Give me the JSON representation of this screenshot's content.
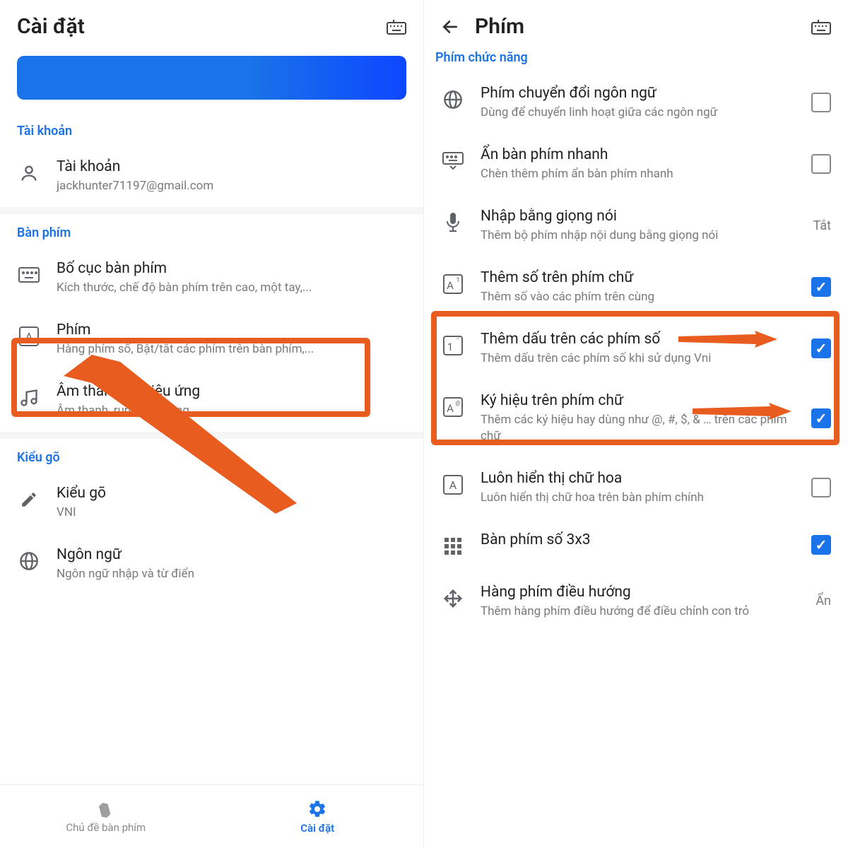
{
  "left": {
    "header_title": "Cài đặt",
    "sections": {
      "account": {
        "header": "Tài khoản",
        "item_title": "Tài khoản",
        "item_sub": "jackhunter71197@gmail.com"
      },
      "keyboard": {
        "header": "Bàn phím",
        "layout_title": "Bố cục bàn phím",
        "layout_sub": "Kích thước, chế độ bàn phím trên cao, một tay,...",
        "keys_title": "Phím",
        "keys_sub": "Hàng phím số, Bật/tắt các phím trên bàn phím,...",
        "sound_title": "Âm thanh và hiệu ứng",
        "sound_sub": "Âm thanh, rung, hiệu ứng"
      },
      "typing": {
        "header": "Kiểu gõ",
        "method_title": "Kiểu gõ",
        "method_sub": "VNI",
        "lang_title": "Ngôn ngữ",
        "lang_sub": "Ngôn ngữ nhập và từ điển"
      }
    },
    "nav": {
      "themes": "Chủ đề bàn phím",
      "settings": "Cài đặt"
    }
  },
  "right": {
    "header_title": "Phím",
    "section_header": "Phím chức năng",
    "items": {
      "lang_switch": {
        "title": "Phím chuyển đổi ngôn ngữ",
        "sub": "Dùng để chuyển linh hoạt giữa các ngôn ngữ"
      },
      "hide_kb": {
        "title": "Ẩn bàn phím nhanh",
        "sub": "Chèn thêm phím ẩn bàn phím nhanh"
      },
      "voice": {
        "title": "Nhập bằng giọng nói",
        "sub": "Thêm bộ phím nhập nội dung bằng giọng nói",
        "trailing": "Tắt"
      },
      "num_on_letter": {
        "title": "Thêm số trên phím chữ",
        "sub": "Thêm số vào các phím trên cùng"
      },
      "mark_on_num": {
        "title": "Thêm dấu trên các phím số",
        "sub": "Thêm dấu trên các phím số khi sử dụng Vni"
      },
      "sym_on_letter": {
        "title": "Ký hiệu trên phím chữ",
        "sub": "Thêm các ký hiệu hay dùng như @, #, $, & … trên các phím chữ"
      },
      "always_caps": {
        "title": "Luôn hiển thị chữ hoa",
        "sub": "Luôn hiển thị chữ hoa trên bàn phím chính"
      },
      "numpad3x3": {
        "title": "Bàn phím số 3x3",
        "sub": ""
      },
      "arrow_row": {
        "title": "Hàng phím điều hướng",
        "sub": "Thêm hàng phím điều hướng để điều chỉnh con trỏ",
        "trailing": "Ẩn"
      }
    }
  }
}
